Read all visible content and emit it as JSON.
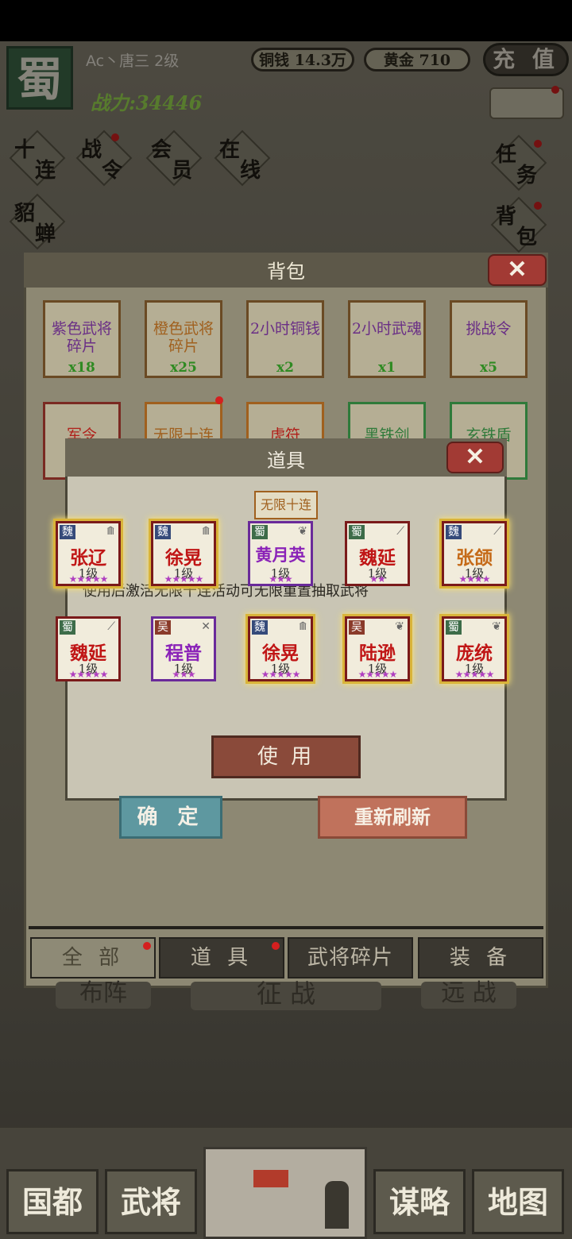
{
  "top_bar": {
    "kingdom": "蜀",
    "player_name": "Ac丶唐三  2级",
    "copper_label": "铜钱 14.3万",
    "gold_label": "黄金 710",
    "recharge_label": "充 值",
    "power_label": "战力:34446"
  },
  "left_menu": [
    {
      "top": "十",
      "bottom": "连"
    },
    {
      "top": "战",
      "bottom": "令"
    },
    {
      "top": "会",
      "bottom": "员"
    },
    {
      "top": "在",
      "bottom": "线"
    },
    {
      "top": "貂",
      "bottom": "蝉"
    }
  ],
  "right_menu": [
    {
      "top": "任",
      "bottom": "务"
    },
    {
      "top": "背",
      "bottom": "包"
    }
  ],
  "bag": {
    "title": "背包",
    "close": "✕",
    "items": [
      {
        "name": "紫色武将碎片",
        "count": "x18"
      },
      {
        "name": "橙色武将碎片",
        "count": "x25"
      },
      {
        "name": "2小时铜钱",
        "count": "x2"
      },
      {
        "name": "2小时武魂",
        "count": "x1"
      },
      {
        "name": "挑战令",
        "count": "x5"
      }
    ],
    "row2": [
      "军令",
      "无限十连",
      "虎符",
      "黑铁剑",
      "玄铁盾"
    ],
    "tabs": [
      "全 部",
      "道 具",
      "武将碎片",
      "装 备"
    ]
  },
  "dialog": {
    "title": "道具",
    "close": "✕",
    "item_label": "无限十连",
    "description": "使用后激活无限十连活动可无限重置抽取武将",
    "use_label": "使 用",
    "confirm_label": "确 定",
    "refresh_label": "重新刷新",
    "heroes": [
      {
        "kingdom": "魏",
        "name": "张辽",
        "level": "1级",
        "stars": "★★★★★",
        "frame": "red",
        "glow": true
      },
      {
        "kingdom": "魏",
        "name": "徐晃",
        "level": "1级",
        "stars": "★★★★★",
        "frame": "red",
        "glow": true
      },
      {
        "kingdom": "蜀",
        "name": "黄月英",
        "level": "1级",
        "stars": "★★★",
        "frame": "purple",
        "glow": false
      },
      {
        "kingdom": "蜀",
        "name": "魏延",
        "level": "1级",
        "stars": "★★",
        "frame": "red",
        "glow": false
      },
      {
        "kingdom": "魏",
        "name": "张颌",
        "level": "1级",
        "stars": "★★★★",
        "frame": "red",
        "glow": true
      },
      {
        "kingdom": "蜀",
        "name": "魏延",
        "level": "1级",
        "stars": "★★★★★",
        "frame": "red",
        "glow": false
      },
      {
        "kingdom": "吴",
        "name": "程普",
        "level": "1级",
        "stars": "★★★",
        "frame": "purple",
        "glow": false
      },
      {
        "kingdom": "魏",
        "name": "徐晃",
        "level": "1级",
        "stars": "★★★★★",
        "frame": "red",
        "glow": true
      },
      {
        "kingdom": "吴",
        "name": "陆逊",
        "level": "1级",
        "stars": "★★★★★",
        "frame": "red",
        "glow": true
      },
      {
        "kingdom": "蜀",
        "name": "庞统",
        "level": "1级",
        "stars": "★★★★★",
        "frame": "red",
        "glow": true
      }
    ]
  },
  "bottom_nav": {
    "left1": "国都",
    "left2": "武将",
    "right1": "谋略",
    "right2": "地图",
    "behind_left": "布阵",
    "behind_mid": "征 战",
    "behind_right": "远 战"
  }
}
